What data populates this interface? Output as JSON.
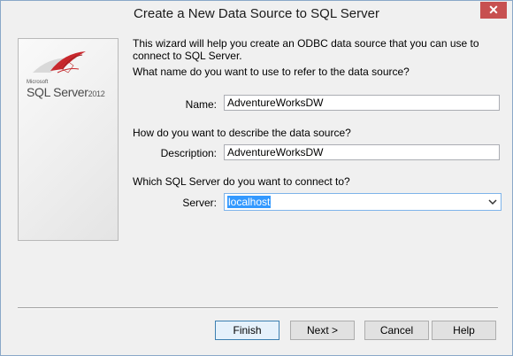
{
  "window": {
    "title": "Create a New Data Source to SQL Server",
    "close_glyph": "✕"
  },
  "logo": {
    "microsoft": "Microsoft",
    "product": "SQL Server",
    "version": "2012"
  },
  "wizard": {
    "intro": "This wizard will help you create an ODBC data source that you can use to connect to SQL Server.",
    "name_question": "What name do you want to use to refer to the data source?",
    "name_label": "Name:",
    "name_value": "AdventureWorksDW",
    "description_question": "How do you want to describe the data source?",
    "description_label": "Description:",
    "description_value": "AdventureWorksDW",
    "server_question": "Which SQL Server do you want to connect to?",
    "server_label": "Server:",
    "server_value": "localhost"
  },
  "buttons": {
    "finish": "Finish",
    "next": "Next >",
    "cancel": "Cancel",
    "help": "Help"
  },
  "colors": {
    "accent": "#3399ff",
    "close": "#c75050",
    "logo_red": "#c8282d"
  }
}
